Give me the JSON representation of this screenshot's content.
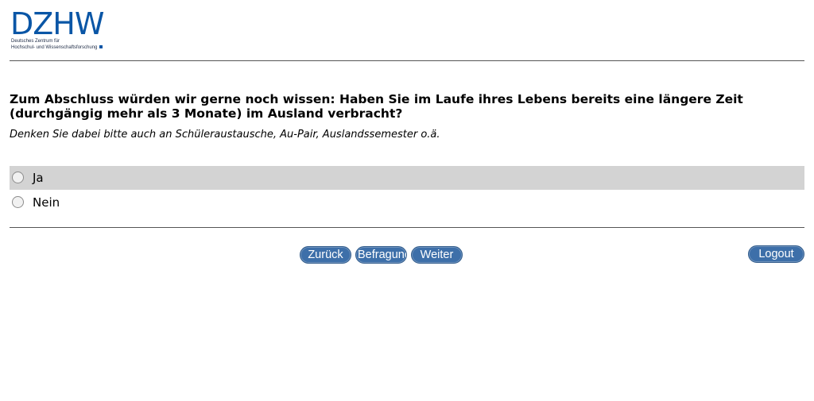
{
  "logo": {
    "letters": "DZHW",
    "line1": "Deutsches Zentrum für",
    "line2": "Hochschul- und Wissenschaftsforschung",
    "brand_color": "#0a56a6"
  },
  "question": {
    "text": "Zum Abschluss würden wir gerne noch wissen: Haben Sie im Laufe ihres Lebens bereits eine längere Zeit (durchgängig mehr als 3 Monate) im Ausland verbracht?",
    "hint": "Denken Sie dabei bitte auch an Schüleraustausche, Au-Pair, Auslandssemester o.ä.",
    "options": [
      {
        "label": "Ja",
        "selected": false
      },
      {
        "label": "Nein",
        "selected": false
      }
    ]
  },
  "nav": {
    "back_label": "Zurück",
    "survey_label": "Befragung",
    "next_label": "Weiter",
    "logout_label": "Logout",
    "button_color": "#3d6fa9"
  }
}
